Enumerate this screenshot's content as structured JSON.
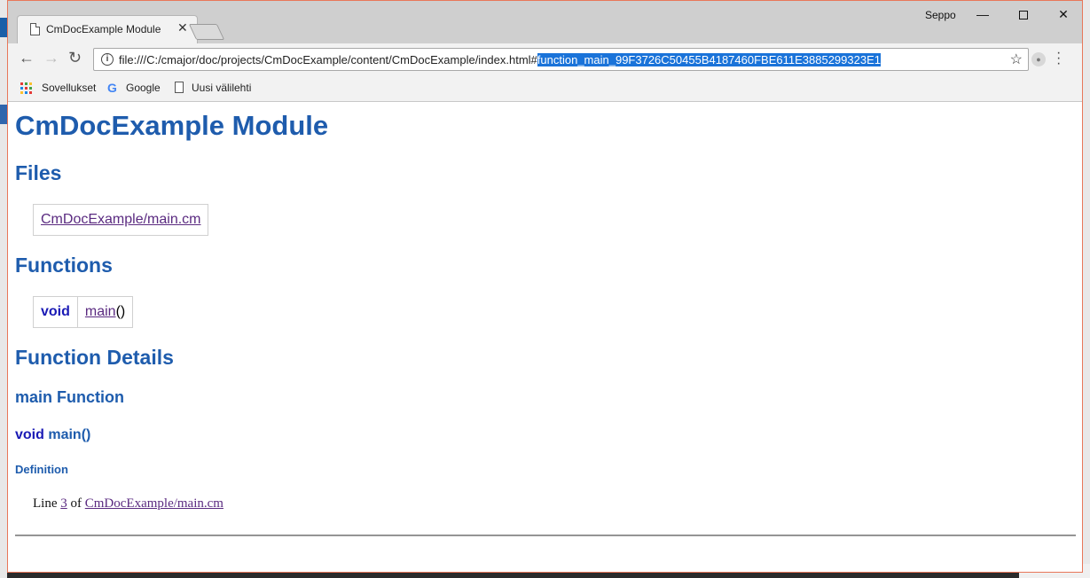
{
  "browser": {
    "tab_title": "CmDocExample Module",
    "profile_name": "Seppo",
    "url_base": "file:///C:/cmajor/doc/projects/CmDocExample/content/CmDocExample/index.html#",
    "url_fragment": "function_main_99F3726C50455B4187460FBE611E3885299323E1"
  },
  "bookmarks": [
    {
      "label": "Sovellukset"
    },
    {
      "label": "Google"
    },
    {
      "label": "Uusi välilehti"
    }
  ],
  "page": {
    "title": "CmDocExample Module",
    "files_heading": "Files",
    "files": [
      {
        "label": "CmDocExample/main.cm"
      }
    ],
    "functions_heading": "Functions",
    "functions": [
      {
        "return_type": "void",
        "name": "main",
        "params": "()"
      }
    ],
    "details_heading": "Function Details",
    "detail": {
      "heading": "main Function",
      "signature_kw": "void",
      "signature_rest": "main()",
      "definition_heading": "Definition",
      "line_prefix": "Line",
      "line_number": "3",
      "of_text": "of",
      "file_link": "CmDocExample/main.cm"
    }
  }
}
